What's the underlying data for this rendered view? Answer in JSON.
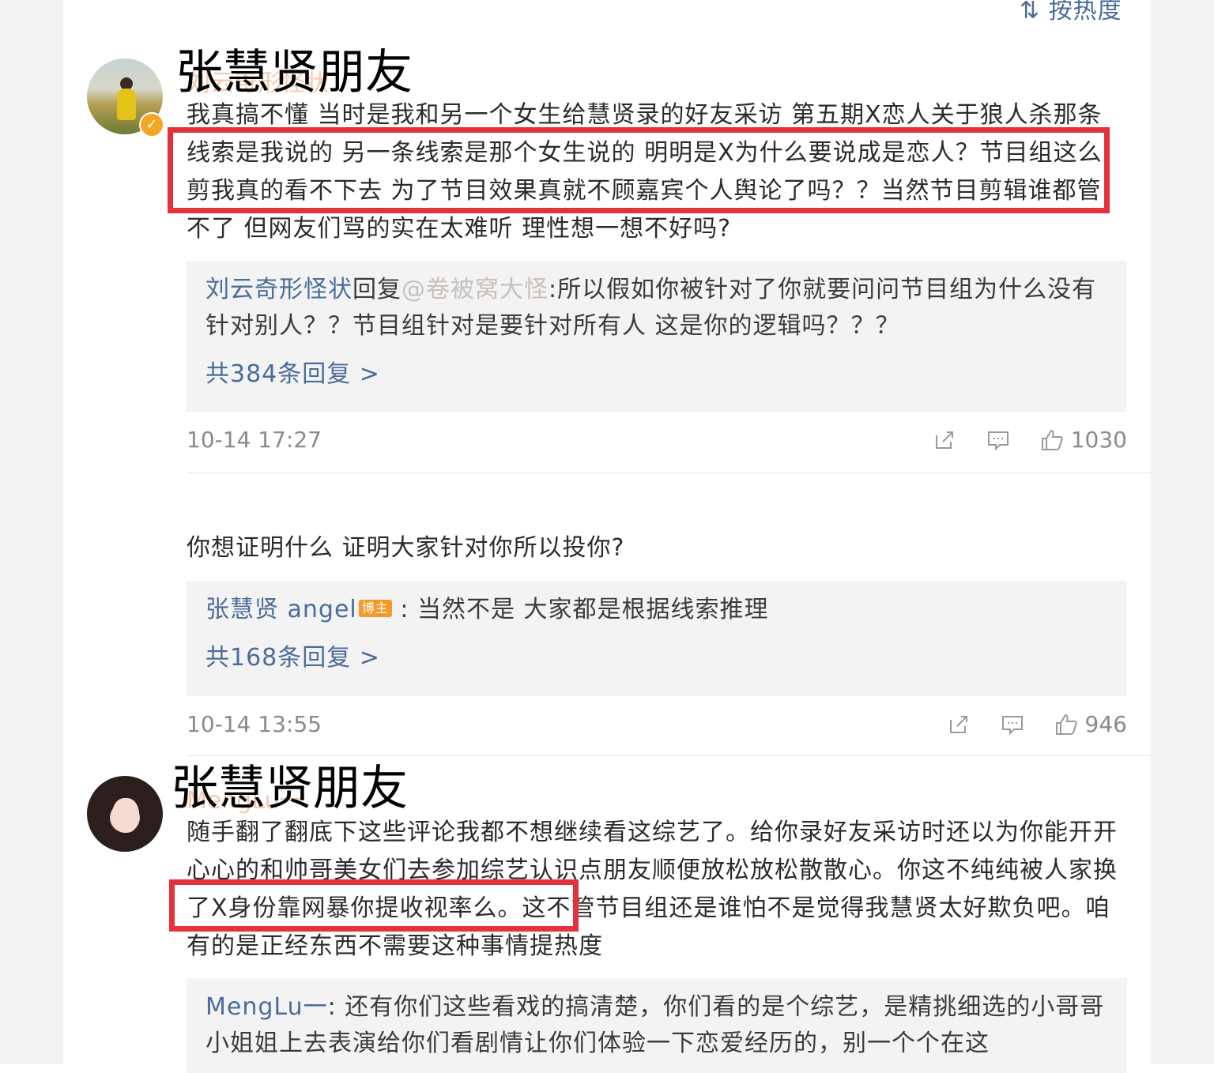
{
  "sort_label": "按热度",
  "comments": [
    {
      "overlay_name": "张慧贤朋友",
      "ghost_name": "刘云奇形怪状",
      "text": "我真搞不懂 当时是我和另一个女生给慧贤录的好友采访 第五期X恋人关于狼人杀那条线索是我说的 另一条线索是那个女生说的 明明是X为什么要说成是恋人？节目组这么剪我真的看不下去 为了节目效果真就不顾嘉宾个人舆论了吗？？当然节目剪辑谁都管不了 但网友们骂的实在太难听 理性想一想不好吗?",
      "reply": {
        "author": "刘云奇形怪状",
        "verb": "回复",
        "mention": "@卷被窝大怪",
        "text": ":所以假如你被针对了你就要问问节目组为什么没有针对别人？？节目组针对是要针对所有人 这是你的逻辑吗？？？",
        "more": "共384条回复 >"
      },
      "time": "10-14 17:27",
      "likes": "1030"
    },
    {
      "text": "你想证明什么 证明大家针对你所以投你?",
      "reply": {
        "author": "张慧贤 angel",
        "badge": "博主",
        "text": " : 当然不是 大家都是根据线索推理",
        "more": "共168条回复 >"
      },
      "time": "10-14 13:55",
      "likes": "946"
    },
    {
      "overlay_name": "张慧贤朋友",
      "ghost_name": "MengLu一",
      "text": "随手翻了翻底下这些评论我都不想继续看这综艺了。给你录好友采访时还以为你能开开心心的和帅哥美女们去参加综艺认识点朋友顺便放松放松散散心。你这不纯纯被人家换了X身份靠网暴你提收视率么。这不管节目组还是谁怕不是觉得我慧贤太好欺负吧。咱有的是正经东西不需要这种事情提热度",
      "reply": {
        "author": "MengLu一",
        "text": ": 还有你们这些看戏的搞清楚，你们看的是个综艺，是精挑细选的小哥哥小姐姐上去表演给你们看剧情让你们体验一下恋爱经历的，别一个个在这"
      }
    }
  ],
  "icons": [
    "share-icon",
    "comment-icon",
    "like-icon"
  ],
  "colors": {
    "link": "#4b6c99",
    "highlight": "#e4323c",
    "reply_bg": "#f3f3f4"
  }
}
